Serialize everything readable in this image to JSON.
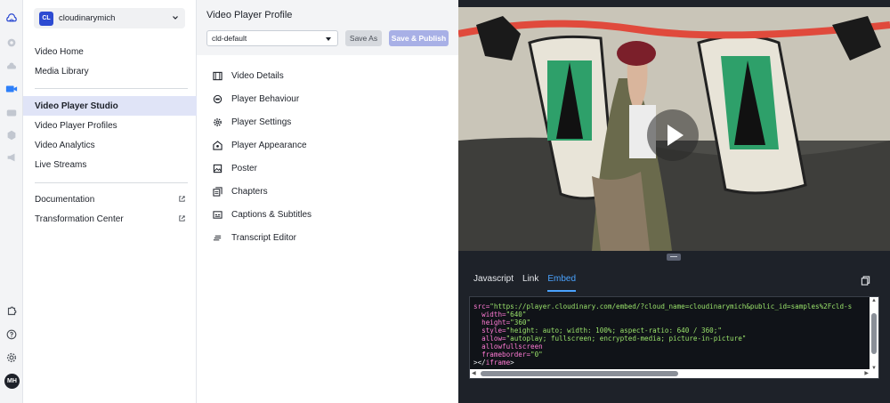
{
  "account": {
    "badge": "CL",
    "name": "cloudinarymich"
  },
  "user": {
    "initials": "MH"
  },
  "nav": {
    "items": [
      {
        "label": "Video Home"
      },
      {
        "label": "Media Library"
      },
      {
        "label": "Video Player Studio"
      },
      {
        "label": "Video Player Profiles"
      },
      {
        "label": "Video Analytics"
      },
      {
        "label": "Live Streams"
      }
    ],
    "links": [
      {
        "label": "Documentation"
      },
      {
        "label": "Transformation Center"
      }
    ],
    "active_index": 2
  },
  "profile": {
    "title": "Video Player Profile",
    "selected": "cld-default",
    "save_as": "Save As",
    "save_publish": "Save & Publish",
    "sections": [
      {
        "label": "Video Details",
        "icon": "film-icon"
      },
      {
        "label": "Player Behaviour",
        "icon": "behaviour-icon"
      },
      {
        "label": "Player Settings",
        "icon": "gear-icon"
      },
      {
        "label": "Player Appearance",
        "icon": "appearance-icon"
      },
      {
        "label": "Poster",
        "icon": "image-icon"
      },
      {
        "label": "Chapters",
        "icon": "chapters-icon"
      },
      {
        "label": "Captions & Subtitles",
        "icon": "captions-icon"
      },
      {
        "label": "Transcript Editor",
        "icon": "transcript-icon"
      }
    ]
  },
  "embed": {
    "tabs": [
      "Javascript",
      "Link",
      "Embed"
    ],
    "active_tab": "Embed",
    "code": {
      "src_attr": "src=",
      "src_val": "\"https://player.cloudinary.com/embed/?cloud_name=cloudinarymich&public_id=samples%2Fcld-s",
      "width_attr": "width=",
      "width_val": "\"640\"",
      "height_attr": "height=",
      "height_val": "\"360\"",
      "style_attr": "style=",
      "style_val": "\"height: auto; width: 100%; aspect-ratio: 640 / 360;\"",
      "allow_attr": "allow=",
      "allow_val": "\"autoplay; fullscreen; encrypted-media; picture-in-picture\"",
      "allowfullscreen": "allowfullscreen",
      "frameborder_attr": "frameborder=",
      "frameborder_val": "\"0\"",
      "close_open": "></",
      "close_tag": "iframe",
      "close_end": ">"
    }
  },
  "colors": {
    "accent": "#2d4bd2",
    "active_nav": "#e0e4f7",
    "publish_button": "#a8b0e6",
    "embed_tab": "#4aa3ff",
    "code_attr": "#ff7ad4",
    "code_string": "#9ae36b"
  }
}
